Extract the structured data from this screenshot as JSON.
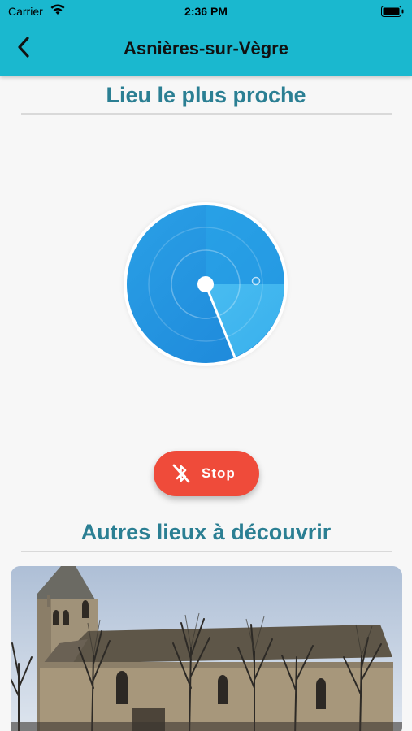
{
  "status_bar": {
    "carrier": "Carrier",
    "time": "2:36 PM"
  },
  "header": {
    "title": "Asnières-sur-Vègre",
    "back_icon": "chevron-left-icon",
    "background_color": "#1ab8cf"
  },
  "nearest_section": {
    "title": "Lieu le plus proche"
  },
  "scanner": {
    "radar_icon": "radar-icon",
    "color": "#2196e0"
  },
  "stop_button": {
    "label": "Stop",
    "icon": "bluetooth-disabled-icon",
    "color": "#ef4b3a"
  },
  "other_section": {
    "title": "Autres lieux à découvrir"
  },
  "places": [
    {
      "image": "church-photo"
    }
  ],
  "colors": {
    "accent": "#2b7f93",
    "page_background": "#f7f7f7"
  }
}
